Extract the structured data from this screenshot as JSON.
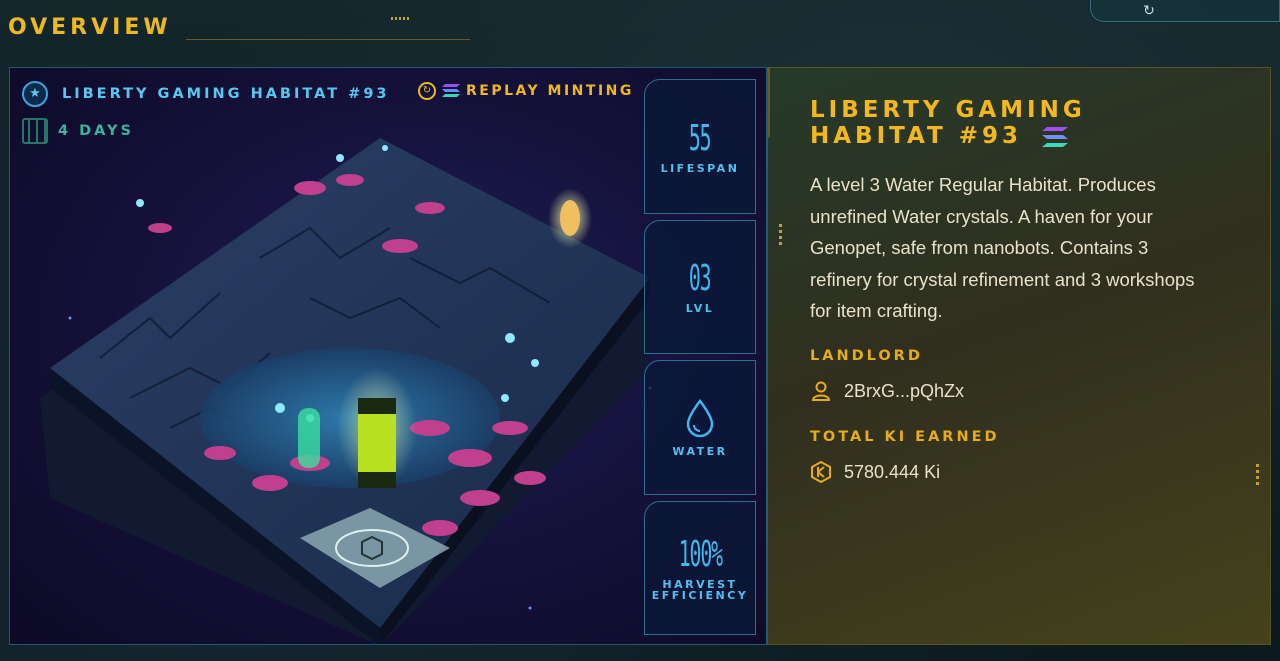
{
  "page": {
    "title": "OVERVIEW"
  },
  "habitat": {
    "name": "LIBERTY GAMING HABITAT #93",
    "replay_label": "REPLAY MINTING",
    "days": "4 DAYS"
  },
  "stats": [
    {
      "value": "55",
      "label": "LIFESPAN"
    },
    {
      "value": "03",
      "label": "LVL"
    },
    {
      "icon": "water-drop-icon",
      "label": "WATER"
    },
    {
      "value": "100%",
      "label": "HARVEST EFFICIENCY"
    }
  ],
  "info": {
    "title_line1": "LIBERTY GAMING",
    "title_line2": "HABITAT #93",
    "description": "A level 3 Water Regular Habitat. Produces unrefined Water crystals. A haven for your Genopet, safe from nanobots. Contains 3 refinery for crystal refinement and 3 workshops for item crafting.",
    "landlord_label": "LANDLORD",
    "landlord_value": "2BrxG...pQhZx",
    "ki_label": "TOTAL KI EARNED",
    "ki_value": "5780.444 Ki"
  },
  "icons": {
    "refresh": "refresh-icon",
    "star_badge": "star-badge-icon",
    "replay": "replay-icon",
    "solana": "solana-icon",
    "calendar": "calendar-icon",
    "user": "user-icon",
    "ki": "ki-token-icon"
  },
  "colors": {
    "accent_gold": "#f0b820",
    "accent_cyan": "#40b8ee",
    "days_teal": "#3ab49a"
  }
}
